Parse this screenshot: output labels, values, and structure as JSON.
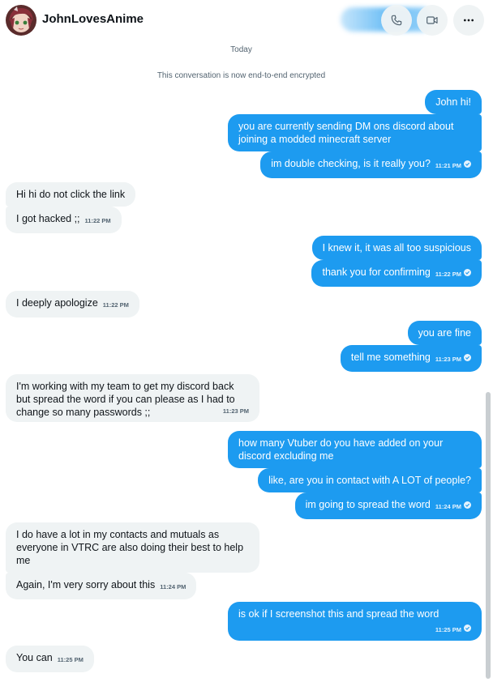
{
  "header": {
    "username": "JohnLovesAnime",
    "icons": [
      "avatar",
      "phone-icon",
      "video-icon",
      "more-icon"
    ],
    "accent": "#1d9bf0"
  },
  "system": {
    "date": "Today",
    "notice": "This conversation is now end-to-end encrypted"
  },
  "messages": [
    {
      "from": "me",
      "text": "John hi!"
    },
    {
      "from": "me",
      "text": "you are currently sending DM ons discord about joining a modded minecraft server"
    },
    {
      "from": "me",
      "text": "im double checking, is it really you?",
      "time": "11:21 PM"
    },
    {
      "from": "them",
      "text": "Hi hi do not click the link"
    },
    {
      "from": "them",
      "text": "I got hacked ;;",
      "time": "11:22 PM"
    },
    {
      "from": "me",
      "text": "I knew it, it was all too suspicious"
    },
    {
      "from": "me",
      "text": "thank you for confirming",
      "time": "11:22 PM"
    },
    {
      "from": "them",
      "text": "I deeply apologize",
      "time": "11:22 PM"
    },
    {
      "from": "me",
      "text": "you are fine"
    },
    {
      "from": "me",
      "text": "tell me something",
      "time": "11:23 PM"
    },
    {
      "from": "them",
      "text": "I'm working with my team to get my discord back but spread the word if you can please as I had to change so many passwords ;;",
      "time": "11:23 PM"
    },
    {
      "from": "me",
      "text": "how many Vtuber do you have added on your discord excluding me"
    },
    {
      "from": "me",
      "text": "like, are you in contact with A LOT  of people?"
    },
    {
      "from": "me",
      "text": "im going to spread the word",
      "time": "11:24 PM"
    },
    {
      "from": "them",
      "text": "I do have a lot in my contacts and mutuals as everyone in VTRC are also doing their best to help me"
    },
    {
      "from": "them",
      "text": "Again, I'm very sorry about this",
      "time": "11:24 PM"
    },
    {
      "from": "me",
      "text": "is ok if I screenshot this and spread the word",
      "time": "11:25 PM"
    },
    {
      "from": "them",
      "text": "You can",
      "time": "11:25 PM"
    }
  ]
}
